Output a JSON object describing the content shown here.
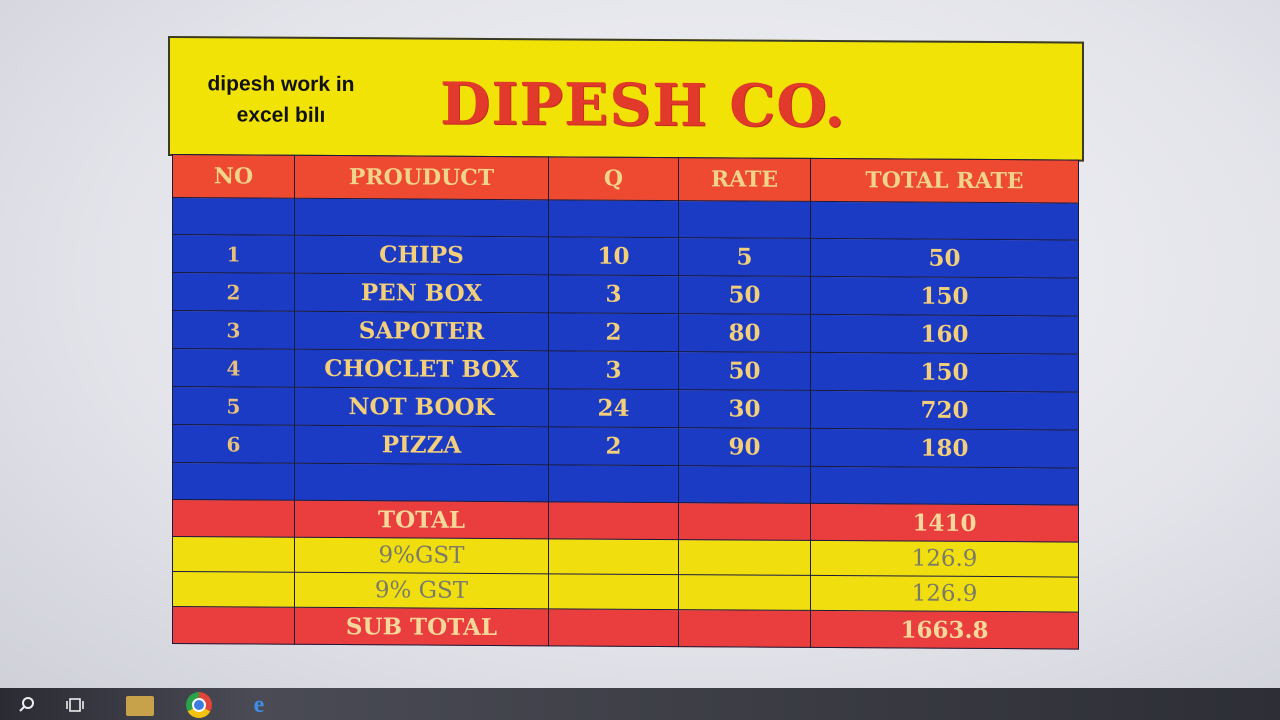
{
  "sheet": {
    "caption_line1": "dipesh work in",
    "caption_line2": "excel bilı",
    "company": "DIPESH CO."
  },
  "table": {
    "headers": [
      "NO",
      "PROUDUCT",
      "Q",
      "RATE",
      "TOTAL RATE"
    ],
    "rows": [
      [
        "1",
        "CHIPS",
        "10",
        "5",
        "50"
      ],
      [
        "2",
        "PEN BOX",
        "3",
        "50",
        "150"
      ],
      [
        "3",
        "SAPOTER",
        "2",
        "80",
        "160"
      ],
      [
        "4",
        "CHOCLET BOX",
        "3",
        "50",
        "150"
      ],
      [
        "5",
        "NOT BOOK",
        "24",
        "30",
        "720"
      ],
      [
        "6",
        "PIZZA",
        "2",
        "90",
        "180"
      ]
    ],
    "summary": [
      {
        "label": "TOTAL",
        "value": "1410",
        "style": "red"
      },
      {
        "label": "9%GST",
        "value": "126.9",
        "style": "yellow"
      },
      {
        "label": "9% GST",
        "value": "126.9",
        "style": "yellow"
      },
      {
        "label": "SUB TOTAL",
        "value": "1663.8",
        "style": "red"
      }
    ]
  },
  "taskbar": {
    "icons": [
      "search-icon",
      "task-view-icon",
      "file-explorer-icon",
      "chrome-icon",
      "edge-icon"
    ]
  },
  "colors": {
    "title_yellow": "#f2e307",
    "header_red": "#ee4a32",
    "row_blue": "#1c3bc4",
    "company_red": "#e23a2a"
  }
}
